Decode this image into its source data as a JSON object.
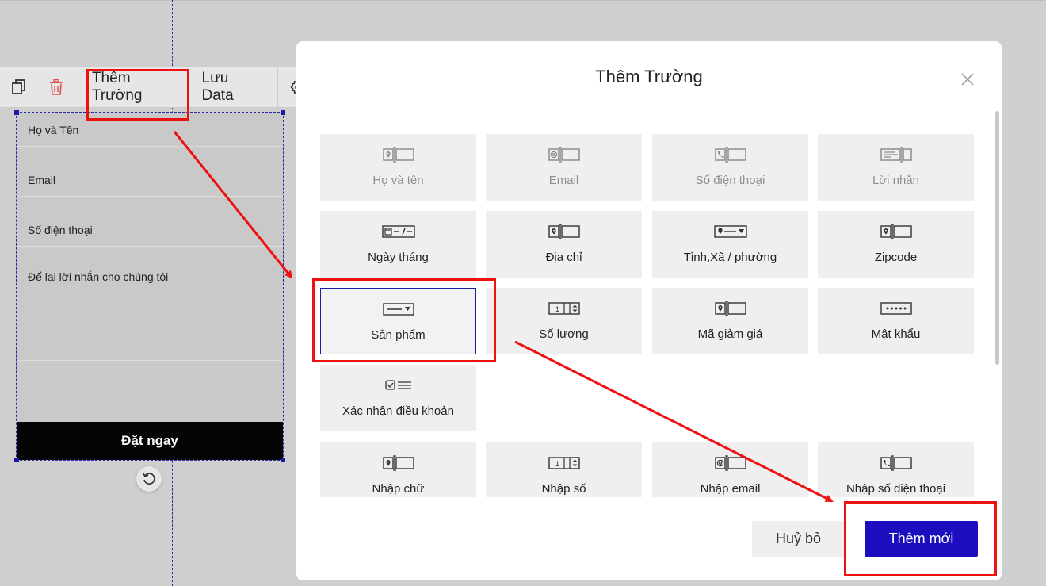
{
  "toolbar": {
    "add_field_label": "Thêm Trường",
    "save_data_label": "Lưu Data"
  },
  "form": {
    "fields": [
      {
        "label": "Họ và Tên"
      },
      {
        "label": "Email"
      },
      {
        "label": "Số điện thoại"
      },
      {
        "label": "Để lại lời nhắn cho chúng tôi"
      }
    ],
    "submit_label": "Đặt ngay"
  },
  "modal": {
    "title": "Thêm Trường",
    "cards": [
      {
        "label": "Họ và tên",
        "icon": "location-input-icon",
        "disabled": true
      },
      {
        "label": "Email",
        "icon": "email-input-icon",
        "disabled": true
      },
      {
        "label": "Số điện thoại",
        "icon": "phone-input-icon",
        "disabled": true
      },
      {
        "label": "Lời nhắn",
        "icon": "message-input-icon",
        "disabled": true
      },
      {
        "label": "Ngày tháng",
        "icon": "date-input-icon",
        "disabled": false
      },
      {
        "label": "Địa chỉ",
        "icon": "location-input-icon",
        "disabled": false
      },
      {
        "label": "Tỉnh,Xã / phường",
        "icon": "location-select-icon",
        "disabled": false
      },
      {
        "label": "Zipcode",
        "icon": "location-input-icon",
        "disabled": false
      },
      {
        "label": "Sản phẩm",
        "icon": "select-dropdown-icon",
        "disabled": false,
        "selected": true
      },
      {
        "label": "Số lượng",
        "icon": "number-stepper-icon",
        "disabled": false
      },
      {
        "label": "Mã giảm giá",
        "icon": "location-input-icon",
        "disabled": false
      },
      {
        "label": "Mật khẩu",
        "icon": "password-input-icon",
        "disabled": false
      },
      {
        "label": "Xác nhận điều khoản",
        "icon": "checkbox-terms-icon",
        "disabled": false
      },
      {
        "label": "Nhập chữ",
        "icon": "location-input-icon",
        "disabled": false
      },
      {
        "label": "Nhập số",
        "icon": "number-stepper-icon",
        "disabled": false
      },
      {
        "label": "Nhập email",
        "icon": "email-input-icon",
        "disabled": false
      },
      {
        "label": "Nhập số điện thoại",
        "icon": "phone-input-icon",
        "disabled": false
      }
    ],
    "cancel_label": "Huỷ bỏ",
    "add_label": "Thêm mới"
  },
  "colors": {
    "primary": "#1c0dbf",
    "annotation": "#ee1111",
    "backdrop": "#cfcfcf"
  }
}
